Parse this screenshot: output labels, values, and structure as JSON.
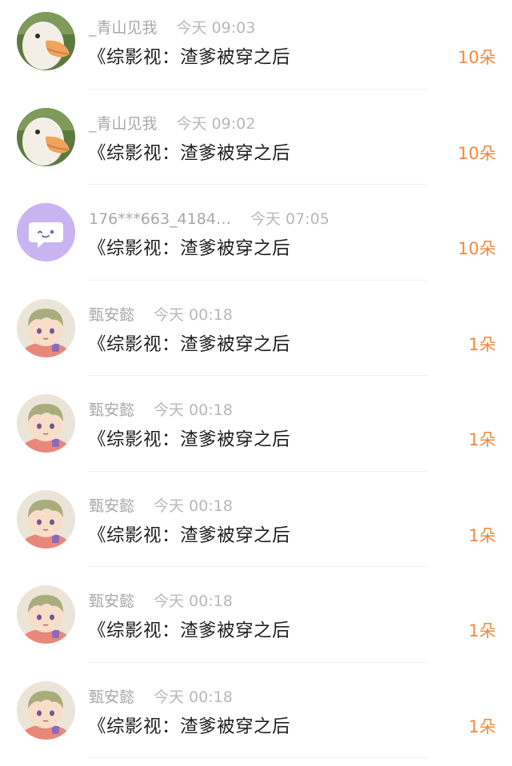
{
  "items": [
    {
      "name": "_青山见我",
      "time": "今天 09:03",
      "title": "《综影视：渣爹被穿之后",
      "amount": "10朵",
      "avatar": "duck-avatar"
    },
    {
      "name": "_青山见我",
      "time": "今天 09:02",
      "title": "《综影视：渣爹被穿之后",
      "amount": "10朵",
      "avatar": "duck-avatar"
    },
    {
      "name": "176***663_4184…",
      "time": "今天 07:05",
      "title": "《综影视：渣爹被穿之后",
      "amount": "10朵",
      "avatar": "chat-bubble-avatar"
    },
    {
      "name": "甄安懿",
      "time": "今天 00:18",
      "title": "《综影视：渣爹被穿之后",
      "amount": "1朵",
      "avatar": "anime-boy-avatar"
    },
    {
      "name": "甄安懿",
      "time": "今天 00:18",
      "title": "《综影视：渣爹被穿之后",
      "amount": "1朵",
      "avatar": "anime-boy-avatar"
    },
    {
      "name": "甄安懿",
      "time": "今天 00:18",
      "title": "《综影视：渣爹被穿之后",
      "amount": "1朵",
      "avatar": "anime-boy-avatar"
    },
    {
      "name": "甄安懿",
      "time": "今天 00:18",
      "title": "《综影视：渣爹被穿之后",
      "amount": "1朵",
      "avatar": "anime-boy-avatar"
    },
    {
      "name": "甄安懿",
      "time": "今天 00:18",
      "title": "《综影视：渣爹被穿之后",
      "amount": "1朵",
      "avatar": "anime-boy-avatar"
    }
  ],
  "colors": {
    "amount": "#f08a3c",
    "meta": "#a8a8a8",
    "title": "#1f1f1f",
    "chat_avatar_bg": "#c9b4f2"
  }
}
